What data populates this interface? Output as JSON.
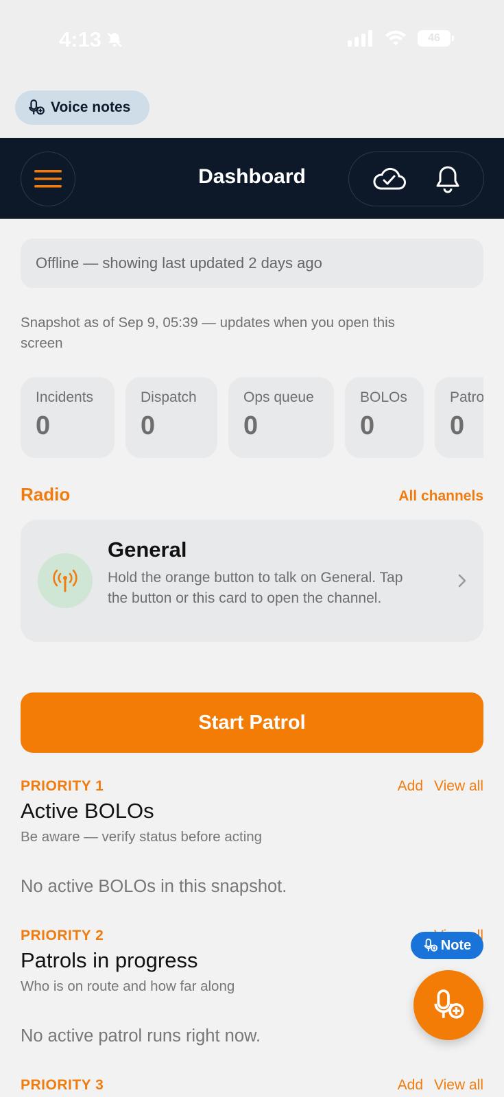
{
  "status_bar": {
    "time": "4:13",
    "battery": "46",
    "icons": [
      "bell-slash-icon",
      "cellular-icon",
      "wifi-icon",
      "battery-icon"
    ]
  },
  "voice_notes": {
    "label": "Voice notes",
    "icon": "mic-plus-icon"
  },
  "header": {
    "title": "Dashboard",
    "icons": [
      "hamburger-menu-icon",
      "cloud-check-icon",
      "bell-icon"
    ],
    "accent": "#f07c0f",
    "background": "#0d1929"
  },
  "offline_banner": "Offline — showing last updated 2 days ago",
  "snapshot_text": "Snapshot as of Sep 9, 05:39 — updates when you open this screen",
  "stats": [
    {
      "label": "Incidents",
      "value": "0"
    },
    {
      "label": "Dispatch",
      "value": "0"
    },
    {
      "label": "Ops queue",
      "value": "0"
    },
    {
      "label": "BOLOs",
      "value": "0"
    },
    {
      "label": "Patrols",
      "value": "0"
    }
  ],
  "radio": {
    "section_title": "Radio",
    "all_channels": "All channels",
    "channel_name": "General",
    "channel_description": "Hold the orange button to talk on General. Tap the button or this card to open the channel.",
    "icon": "antenna-icon"
  },
  "start_patrol": "Start Patrol",
  "priorities": [
    {
      "label": "PRIORITY 1",
      "title": "Active BOLOs",
      "subtitle": "Be aware — verify status before acting",
      "empty": "No active BOLOs in this snapshot.",
      "add": "Add",
      "view_all": "View all"
    },
    {
      "label": "PRIORITY 2",
      "title": "Patrols in progress",
      "subtitle": "Who is on route and how far along",
      "empty": "No active patrol runs right now.",
      "view_all": "View all"
    },
    {
      "label": "PRIORITY 3",
      "add": "Add",
      "view_all": "View all"
    }
  ],
  "note_pill": "Note",
  "colors": {
    "orange": "#f27c06",
    "blue": "#1a73d9",
    "navy": "#0d1929"
  }
}
